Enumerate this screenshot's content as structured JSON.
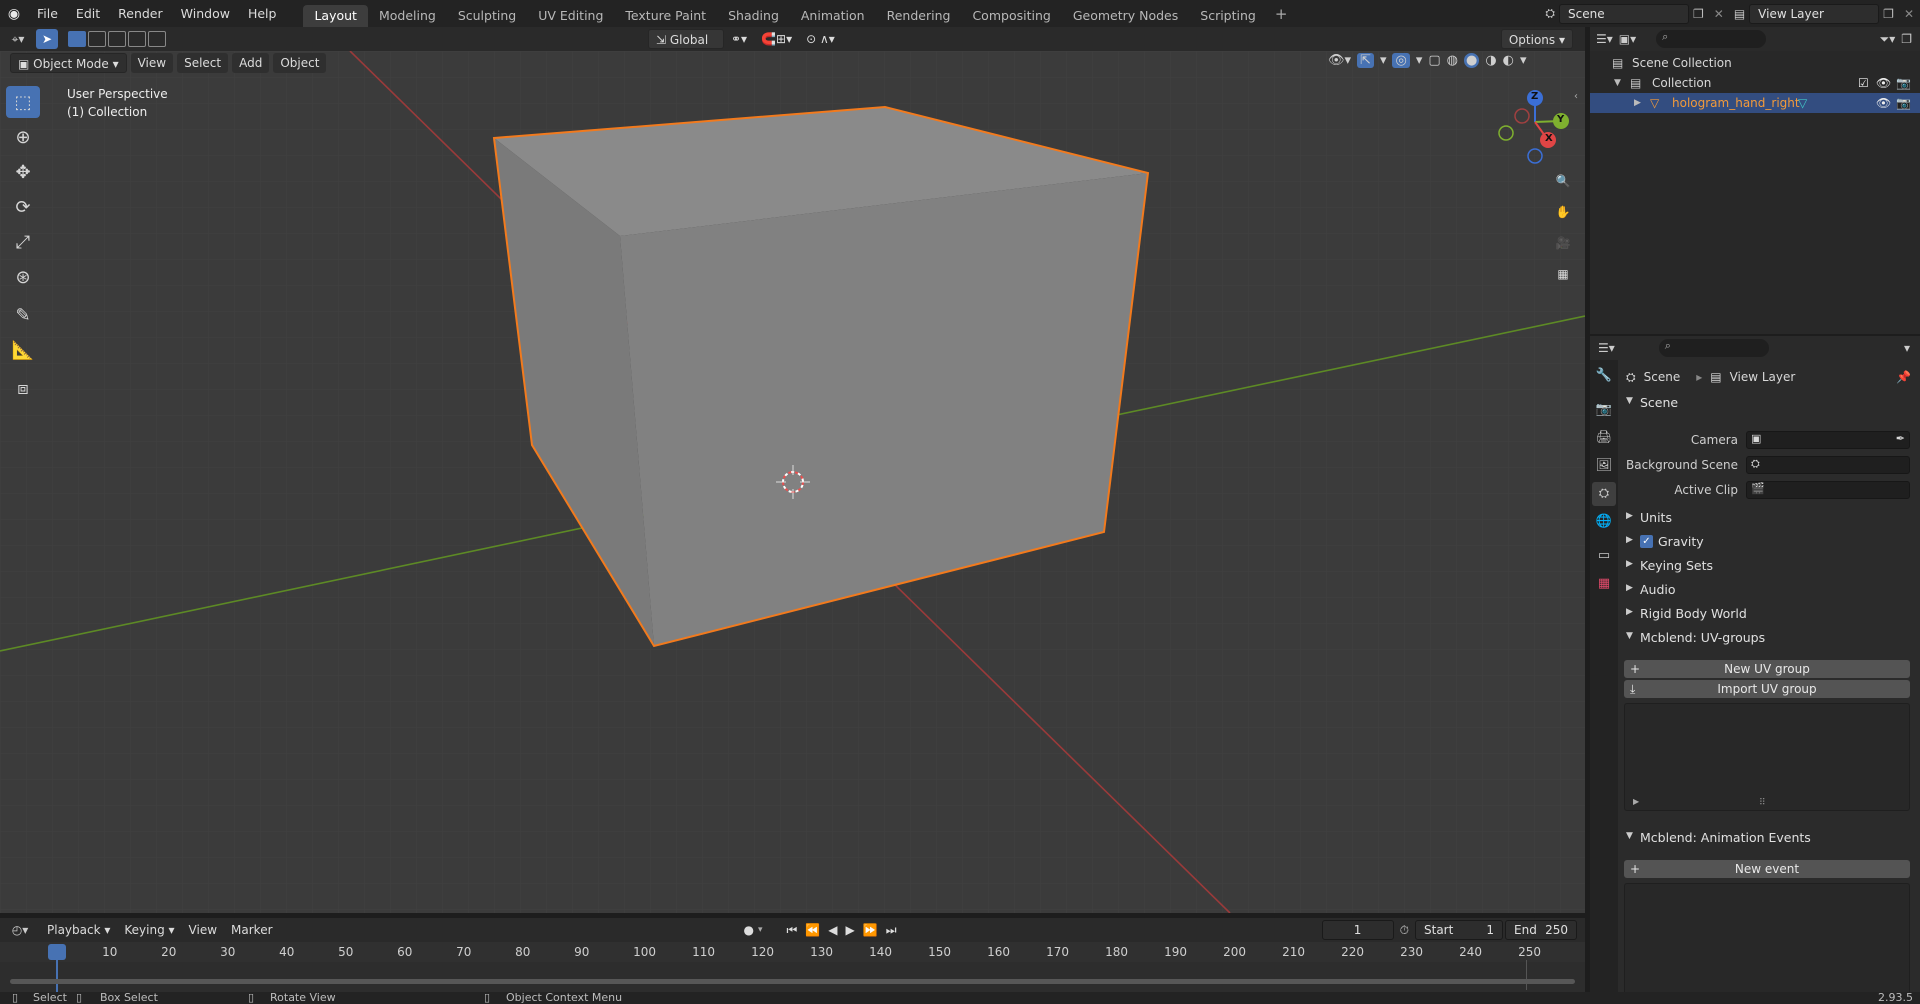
{
  "topbar": {
    "menus": [
      "File",
      "Edit",
      "Render",
      "Window",
      "Help"
    ],
    "workspaces": [
      "Layout",
      "Modeling",
      "Sculpting",
      "UV Editing",
      "Texture Paint",
      "Shading",
      "Animation",
      "Rendering",
      "Compositing",
      "Geometry Nodes",
      "Scripting"
    ],
    "active_workspace": "Layout",
    "scene_name": "Scene",
    "view_layer_name": "View Layer"
  },
  "viewport_header": {
    "mode": "Object Mode",
    "menus": [
      "View",
      "Select",
      "Add",
      "Object"
    ],
    "orientation": "Global",
    "options": "Options"
  },
  "viewport": {
    "view_name": "User Perspective",
    "collection_label": "(1) Collection",
    "gizmo_axes": [
      "Z",
      "Y",
      "X"
    ]
  },
  "outliner": {
    "rows": [
      "Scene Collection",
      "Collection",
      "hologram_hand_right"
    ]
  },
  "properties": {
    "breadcrumb_scene": "Scene",
    "breadcrumb_view_layer": "View Layer",
    "scene_panel": "Scene",
    "camera_label": "Camera",
    "background_scene_label": "Background Scene",
    "active_clip_label": "Active Clip",
    "collapsed_panels": [
      "Units",
      "Gravity",
      "Keying Sets",
      "Audio",
      "Rigid Body World"
    ],
    "uv_groups_panel": "Mcblend: UV-groups",
    "new_uv_group": "New UV group",
    "import_uv_group": "Import UV group",
    "anim_events_panel": "Mcblend: Animation Events",
    "new_event": "New event"
  },
  "timeline": {
    "menus": [
      "Playback",
      "Keying",
      "View",
      "Marker"
    ],
    "current_frame": "1",
    "start_label": "Start",
    "start_value": "1",
    "end_label": "End",
    "end_value": "250",
    "ticks": [
      "1",
      "10",
      "20",
      "30",
      "40",
      "50",
      "60",
      "70",
      "80",
      "90",
      "100",
      "110",
      "120",
      "130",
      "140",
      "150",
      "160",
      "170",
      "180",
      "190",
      "200",
      "210",
      "220",
      "230",
      "240",
      "250"
    ]
  },
  "statusbar": {
    "select": "Select",
    "box_select": "Box Select",
    "rotate_view": "Rotate View",
    "context_menu": "Object Context Menu",
    "version": "2.93.5"
  },
  "colors": {
    "selection_outline": "#f27a1d",
    "active_blue": "#4772b3",
    "x_axis": "#c43a3a",
    "y_axis": "#6a9a2a"
  }
}
